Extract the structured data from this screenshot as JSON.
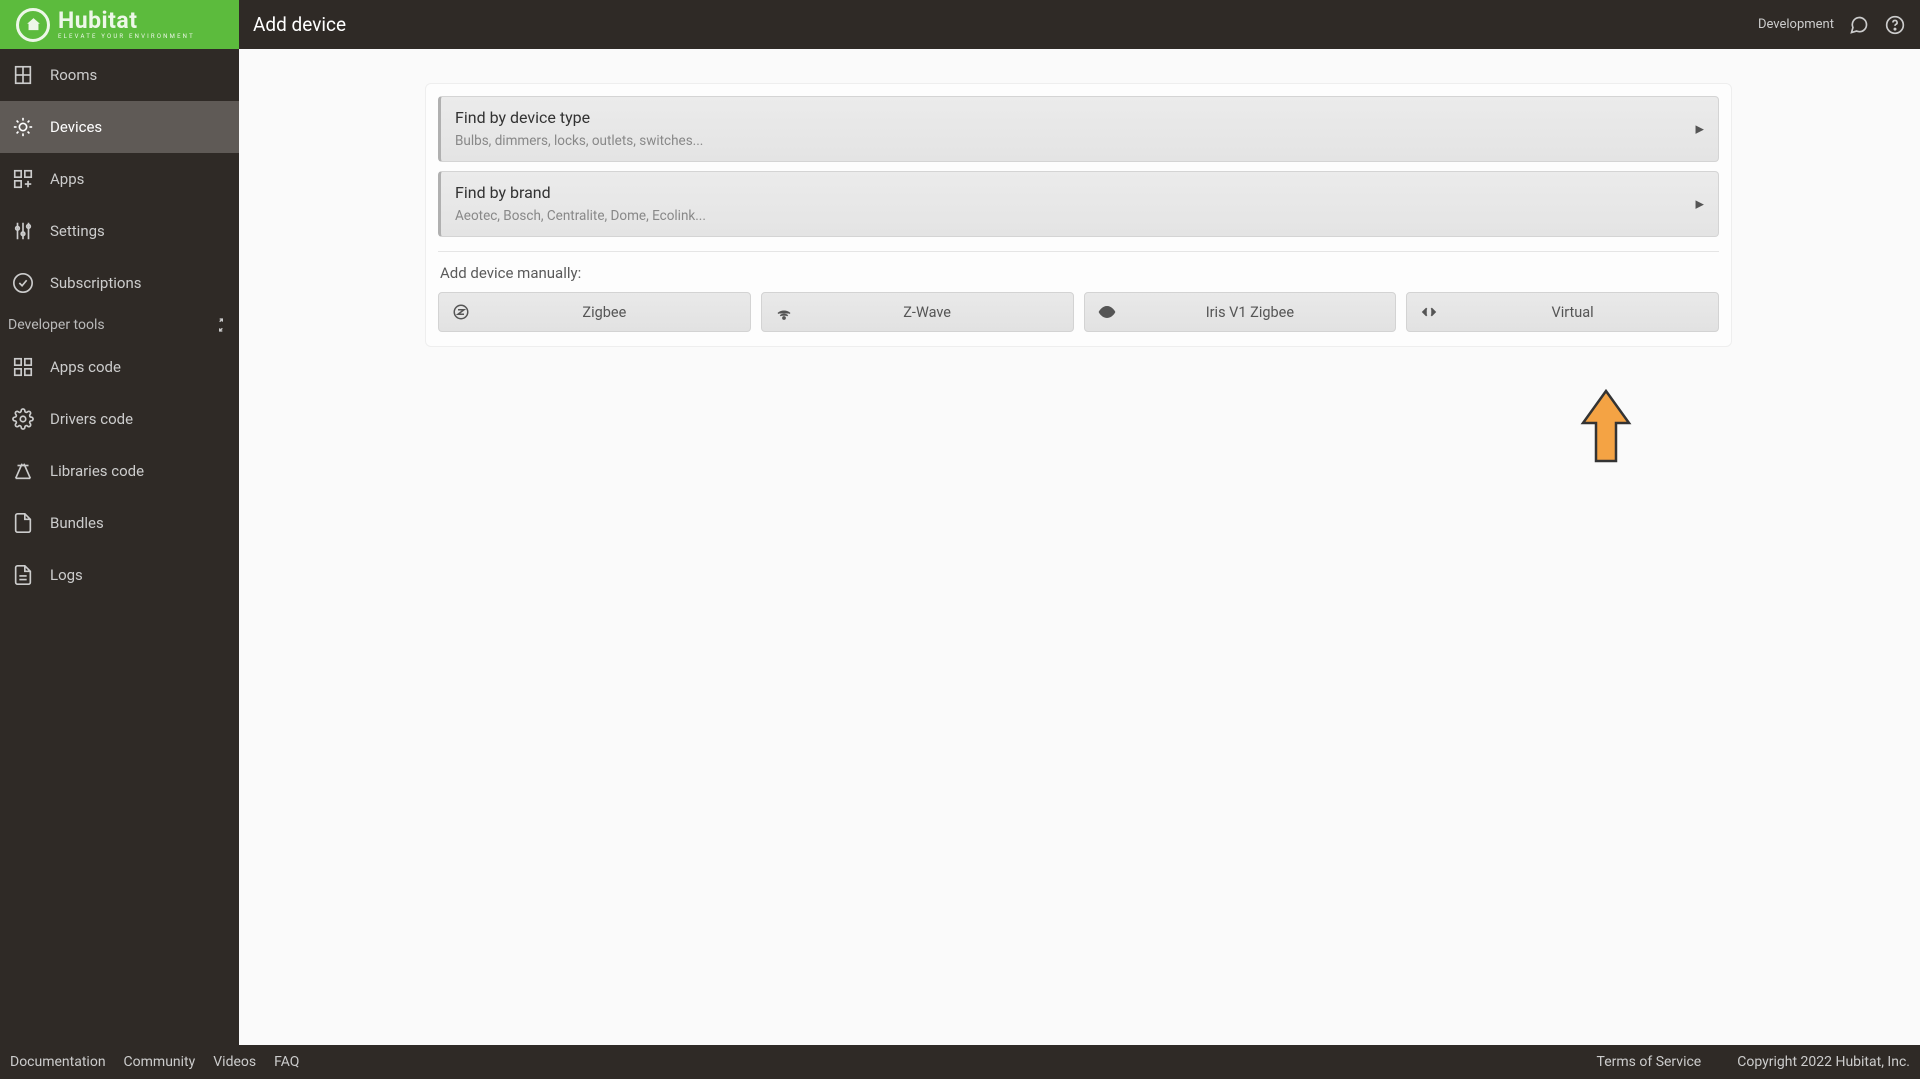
{
  "brand": {
    "name": "Hubitat",
    "tagline": "ELEVATE YOUR ENVIRONMENT"
  },
  "header": {
    "title": "Add device",
    "env": "Development"
  },
  "sidebar": {
    "items": [
      {
        "label": "Rooms"
      },
      {
        "label": "Devices"
      },
      {
        "label": "Apps"
      },
      {
        "label": "Settings"
      },
      {
        "label": "Subscriptions"
      }
    ],
    "dev_section_label": "Developer tools",
    "dev_items": [
      {
        "label": "Apps code"
      },
      {
        "label": "Drivers code"
      },
      {
        "label": "Libraries code"
      },
      {
        "label": "Bundles"
      },
      {
        "label": "Logs"
      }
    ]
  },
  "panels": {
    "by_type": {
      "title": "Find by device type",
      "sub": "Bulbs, dimmers, locks, outlets, switches..."
    },
    "by_brand": {
      "title": "Find by brand",
      "sub": "Aeotec, Bosch, Centralite, Dome, Ecolink..."
    }
  },
  "manual": {
    "label": "Add device manually:",
    "buttons": [
      {
        "label": "Zigbee"
      },
      {
        "label": "Z-Wave"
      },
      {
        "label": "Iris V1 Zigbee"
      },
      {
        "label": "Virtual"
      }
    ]
  },
  "footer": {
    "links": [
      "Documentation",
      "Community",
      "Videos",
      "FAQ"
    ],
    "terms": "Terms of Service",
    "copyright": "Copyright 2022 Hubitat, Inc."
  }
}
